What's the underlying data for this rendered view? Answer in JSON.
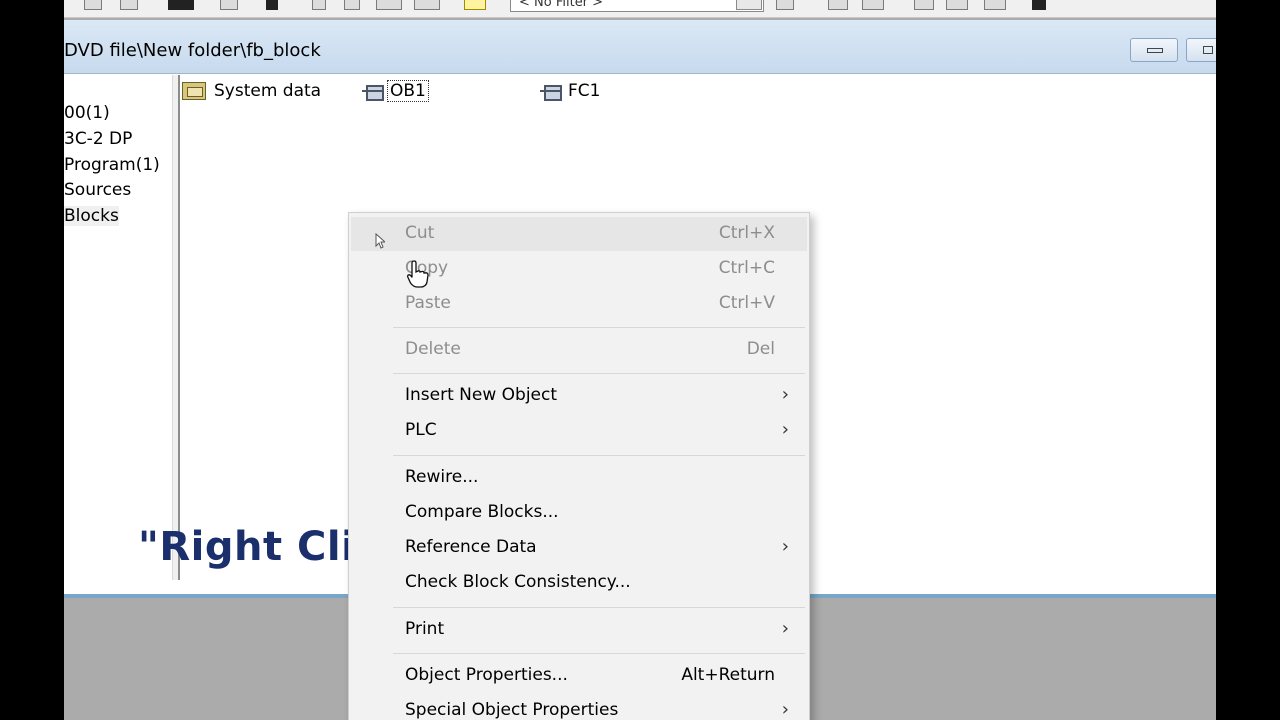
{
  "toolbar": {
    "filter_value": "< No Filter >"
  },
  "window": {
    "title": "DVD file\\New folder\\fb_block",
    "buttons": {
      "minimize": "minimize-button",
      "restore": "restore-button"
    }
  },
  "tree": {
    "items": [
      {
        "label": "00(1)"
      },
      {
        "label": "3C-2 DP"
      },
      {
        "label": "Program(1)"
      },
      {
        "label": "Sources"
      },
      {
        "label": "Blocks"
      }
    ]
  },
  "objects": [
    {
      "label": "System data",
      "icon": "system-data-folder-icon"
    },
    {
      "label": "OB1",
      "icon": "block-icon"
    },
    {
      "label": "FC1",
      "icon": "block-icon"
    }
  ],
  "caption": "\"Right Click\"",
  "context_menu": {
    "items": [
      {
        "label": "Cut",
        "shortcut": "Ctrl+X",
        "disabled": true
      },
      {
        "label": "Copy",
        "shortcut": "Ctrl+C",
        "disabled": true
      },
      {
        "label": "Paste",
        "shortcut": "Ctrl+V",
        "disabled": true
      },
      {
        "label": "Delete",
        "shortcut": "Del",
        "disabled": true
      },
      {
        "label": "Insert New Object",
        "submenu": true
      },
      {
        "label": "PLC",
        "submenu": true
      },
      {
        "label": "Rewire..."
      },
      {
        "label": "Compare Blocks..."
      },
      {
        "label": "Reference Data",
        "submenu": true
      },
      {
        "label": "Check Block Consistency..."
      },
      {
        "label": "Print",
        "submenu": true
      },
      {
        "label": "Object Properties...",
        "shortcut": "Alt+Return"
      },
      {
        "label": "Special Object Properties",
        "submenu": true
      }
    ],
    "arrow_glyph": "›"
  }
}
